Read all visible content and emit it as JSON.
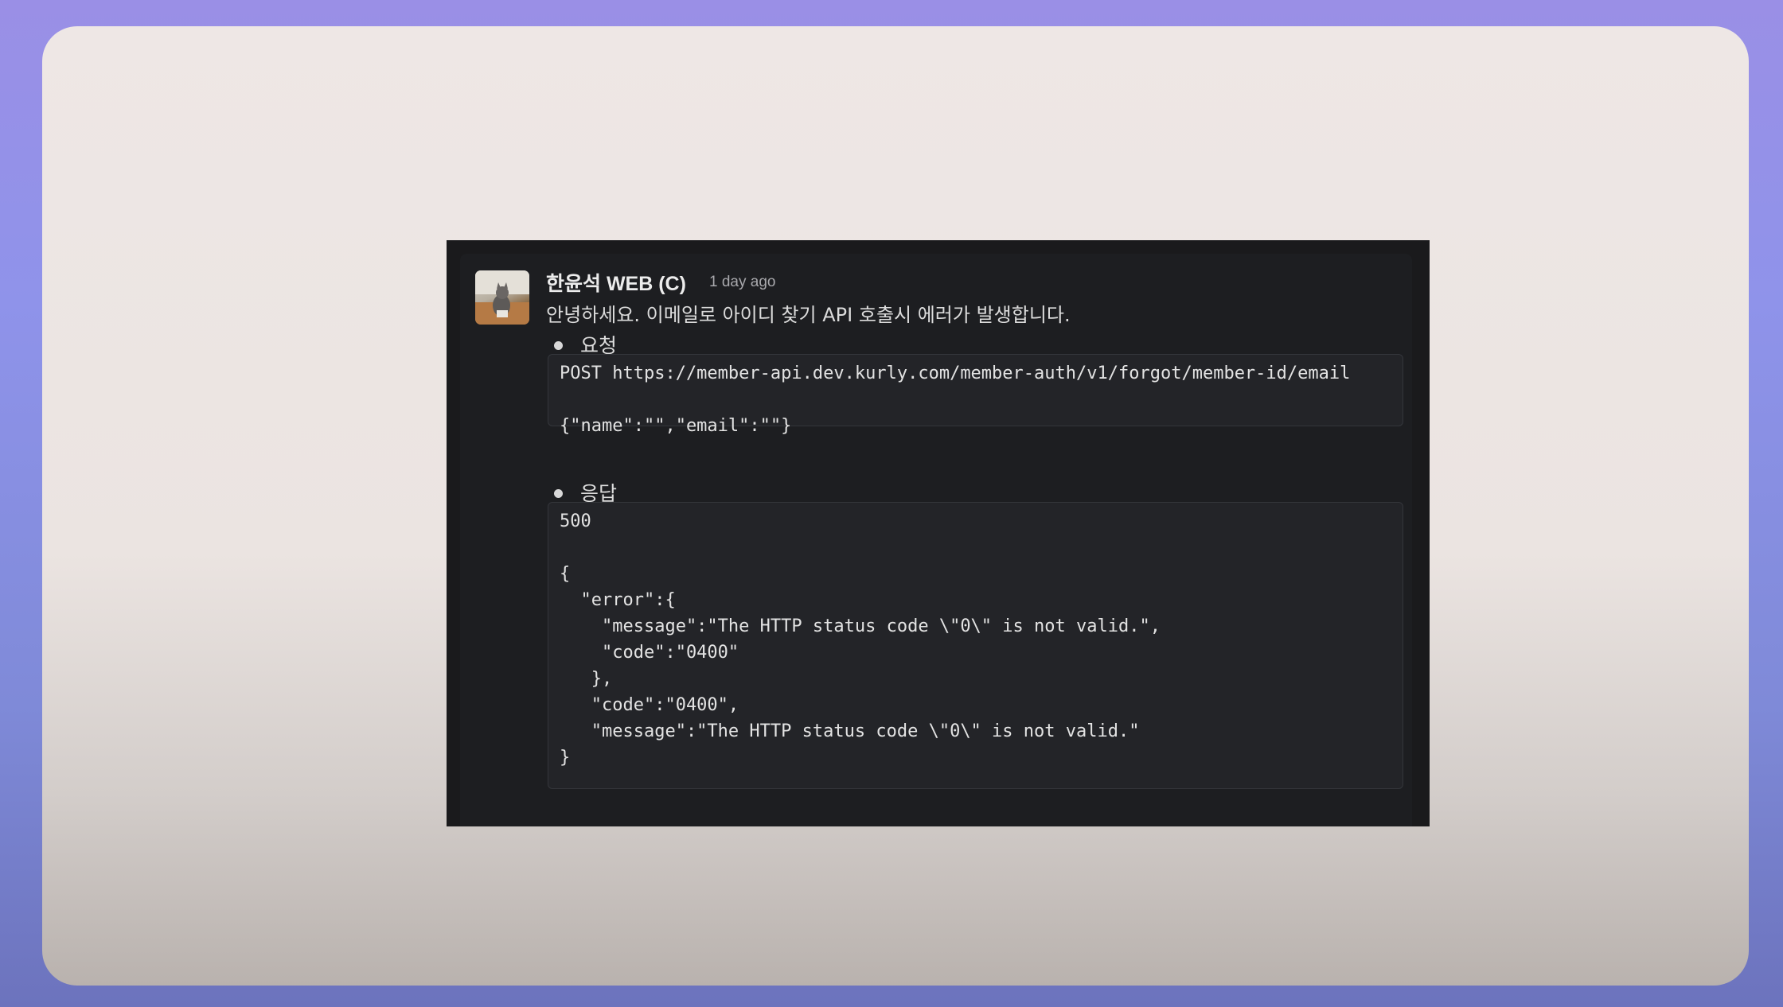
{
  "message": {
    "author": "한윤석 WEB (C)",
    "timestamp": "1 day ago",
    "text": "안녕하세요. 이메일로 아이디 찾기 API 호출시 에러가 발생합니다.",
    "request_label": "요청",
    "request_code": "POST https://member-api.dev.kurly.com/member-auth/v1/forgot/member-id/email\n\n{\"name\":\"\",\"email\":\"\"}",
    "response_label": "응답",
    "response_code": "500\n\n{\n  \"error\":{\n    \"message\":\"The HTTP status code \\\"0\\\" is not valid.\",\n    \"code\":\"0400\"\n   },\n   \"code\":\"0400\",\n   \"message\":\"The HTTP status code \\\"0\\\" is not valid.\"\n}"
  },
  "icons": {
    "avatar": "cat-photo-avatar",
    "bullet": "bullet-dot-icon"
  },
  "colors": {
    "background_gradient_top": "#9a8fe6",
    "card": "#ece5e3",
    "message_bg": "#1d1e21",
    "code_bg": "#232428"
  }
}
